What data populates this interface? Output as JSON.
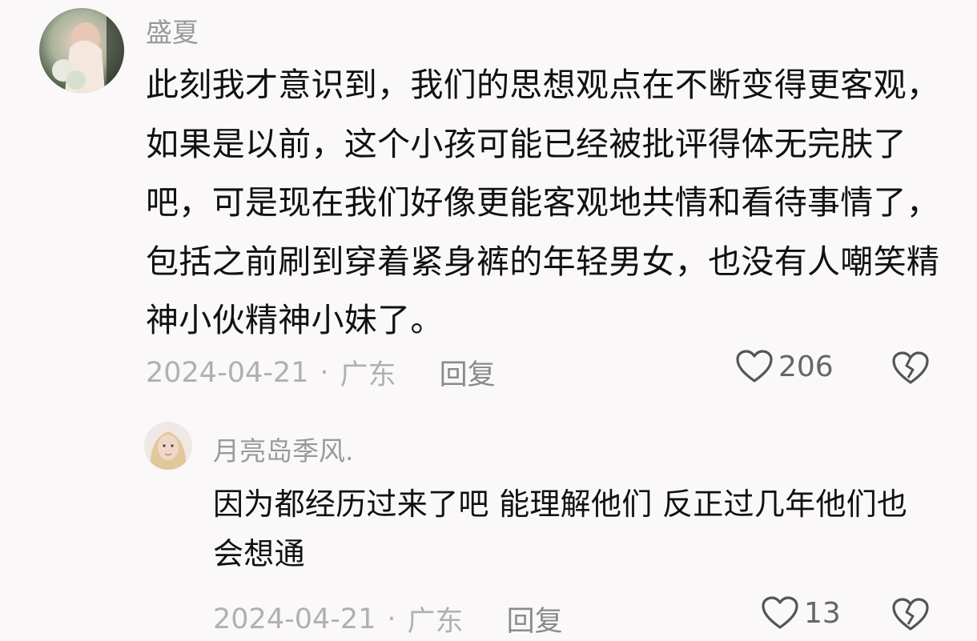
{
  "comments": [
    {
      "username": "盛夏",
      "text": "此刻我才意识到，我们的思想观点在不断变得更客观，如果是以前，这个小孩可能已经被批评得体无完肤了吧，可是现在我们好像更能客观地共情和看待事情了，包括之前刷到穿着紧身裤的年轻男女，也没有人嘲笑精神小伙精神小妹了。",
      "date": "2024-04-21",
      "separator": "·",
      "location": "广东",
      "reply_label": "回复",
      "likes": "206",
      "like_icon": "heart-outline-icon",
      "dislike_icon": "broken-heart-icon"
    },
    {
      "username": "月亮岛季风.",
      "text": "因为都经历过来了吧 能理解他们 反正过几年他们也会想通",
      "date": "2024-04-21",
      "separator": "·",
      "location": "广东",
      "reply_label": "回复",
      "likes": "13",
      "like_icon": "heart-outline-icon",
      "dislike_icon": "broken-heart-icon"
    }
  ],
  "colors": {
    "background": "#faf8f8",
    "text": "#111111",
    "muted": "#9a9a9a",
    "icon": "#555555"
  }
}
